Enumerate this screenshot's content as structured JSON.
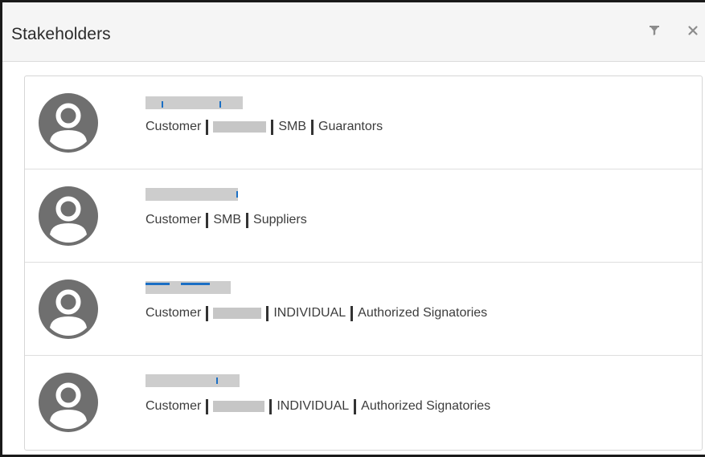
{
  "dialog": {
    "title": "Stakeholders",
    "filter_icon": "filter-icon",
    "close_icon": "close-icon"
  },
  "stakeholders": [
    {
      "type": "Customer",
      "segment": "SMB",
      "role": "Guarantors"
    },
    {
      "type": "Customer",
      "segment": "SMB",
      "role": "Suppliers"
    },
    {
      "type": "Customer",
      "segment": "INDIVIDUAL",
      "role": "Authorized Signatories"
    },
    {
      "type": "Customer",
      "segment": "INDIVIDUAL",
      "role": "Authorized Signatories"
    }
  ],
  "colors": {
    "avatar": "#6f6f6f",
    "link": "#1b6fc4",
    "redaction": "#c6c6c6",
    "header_bg": "#f5f5f5"
  }
}
